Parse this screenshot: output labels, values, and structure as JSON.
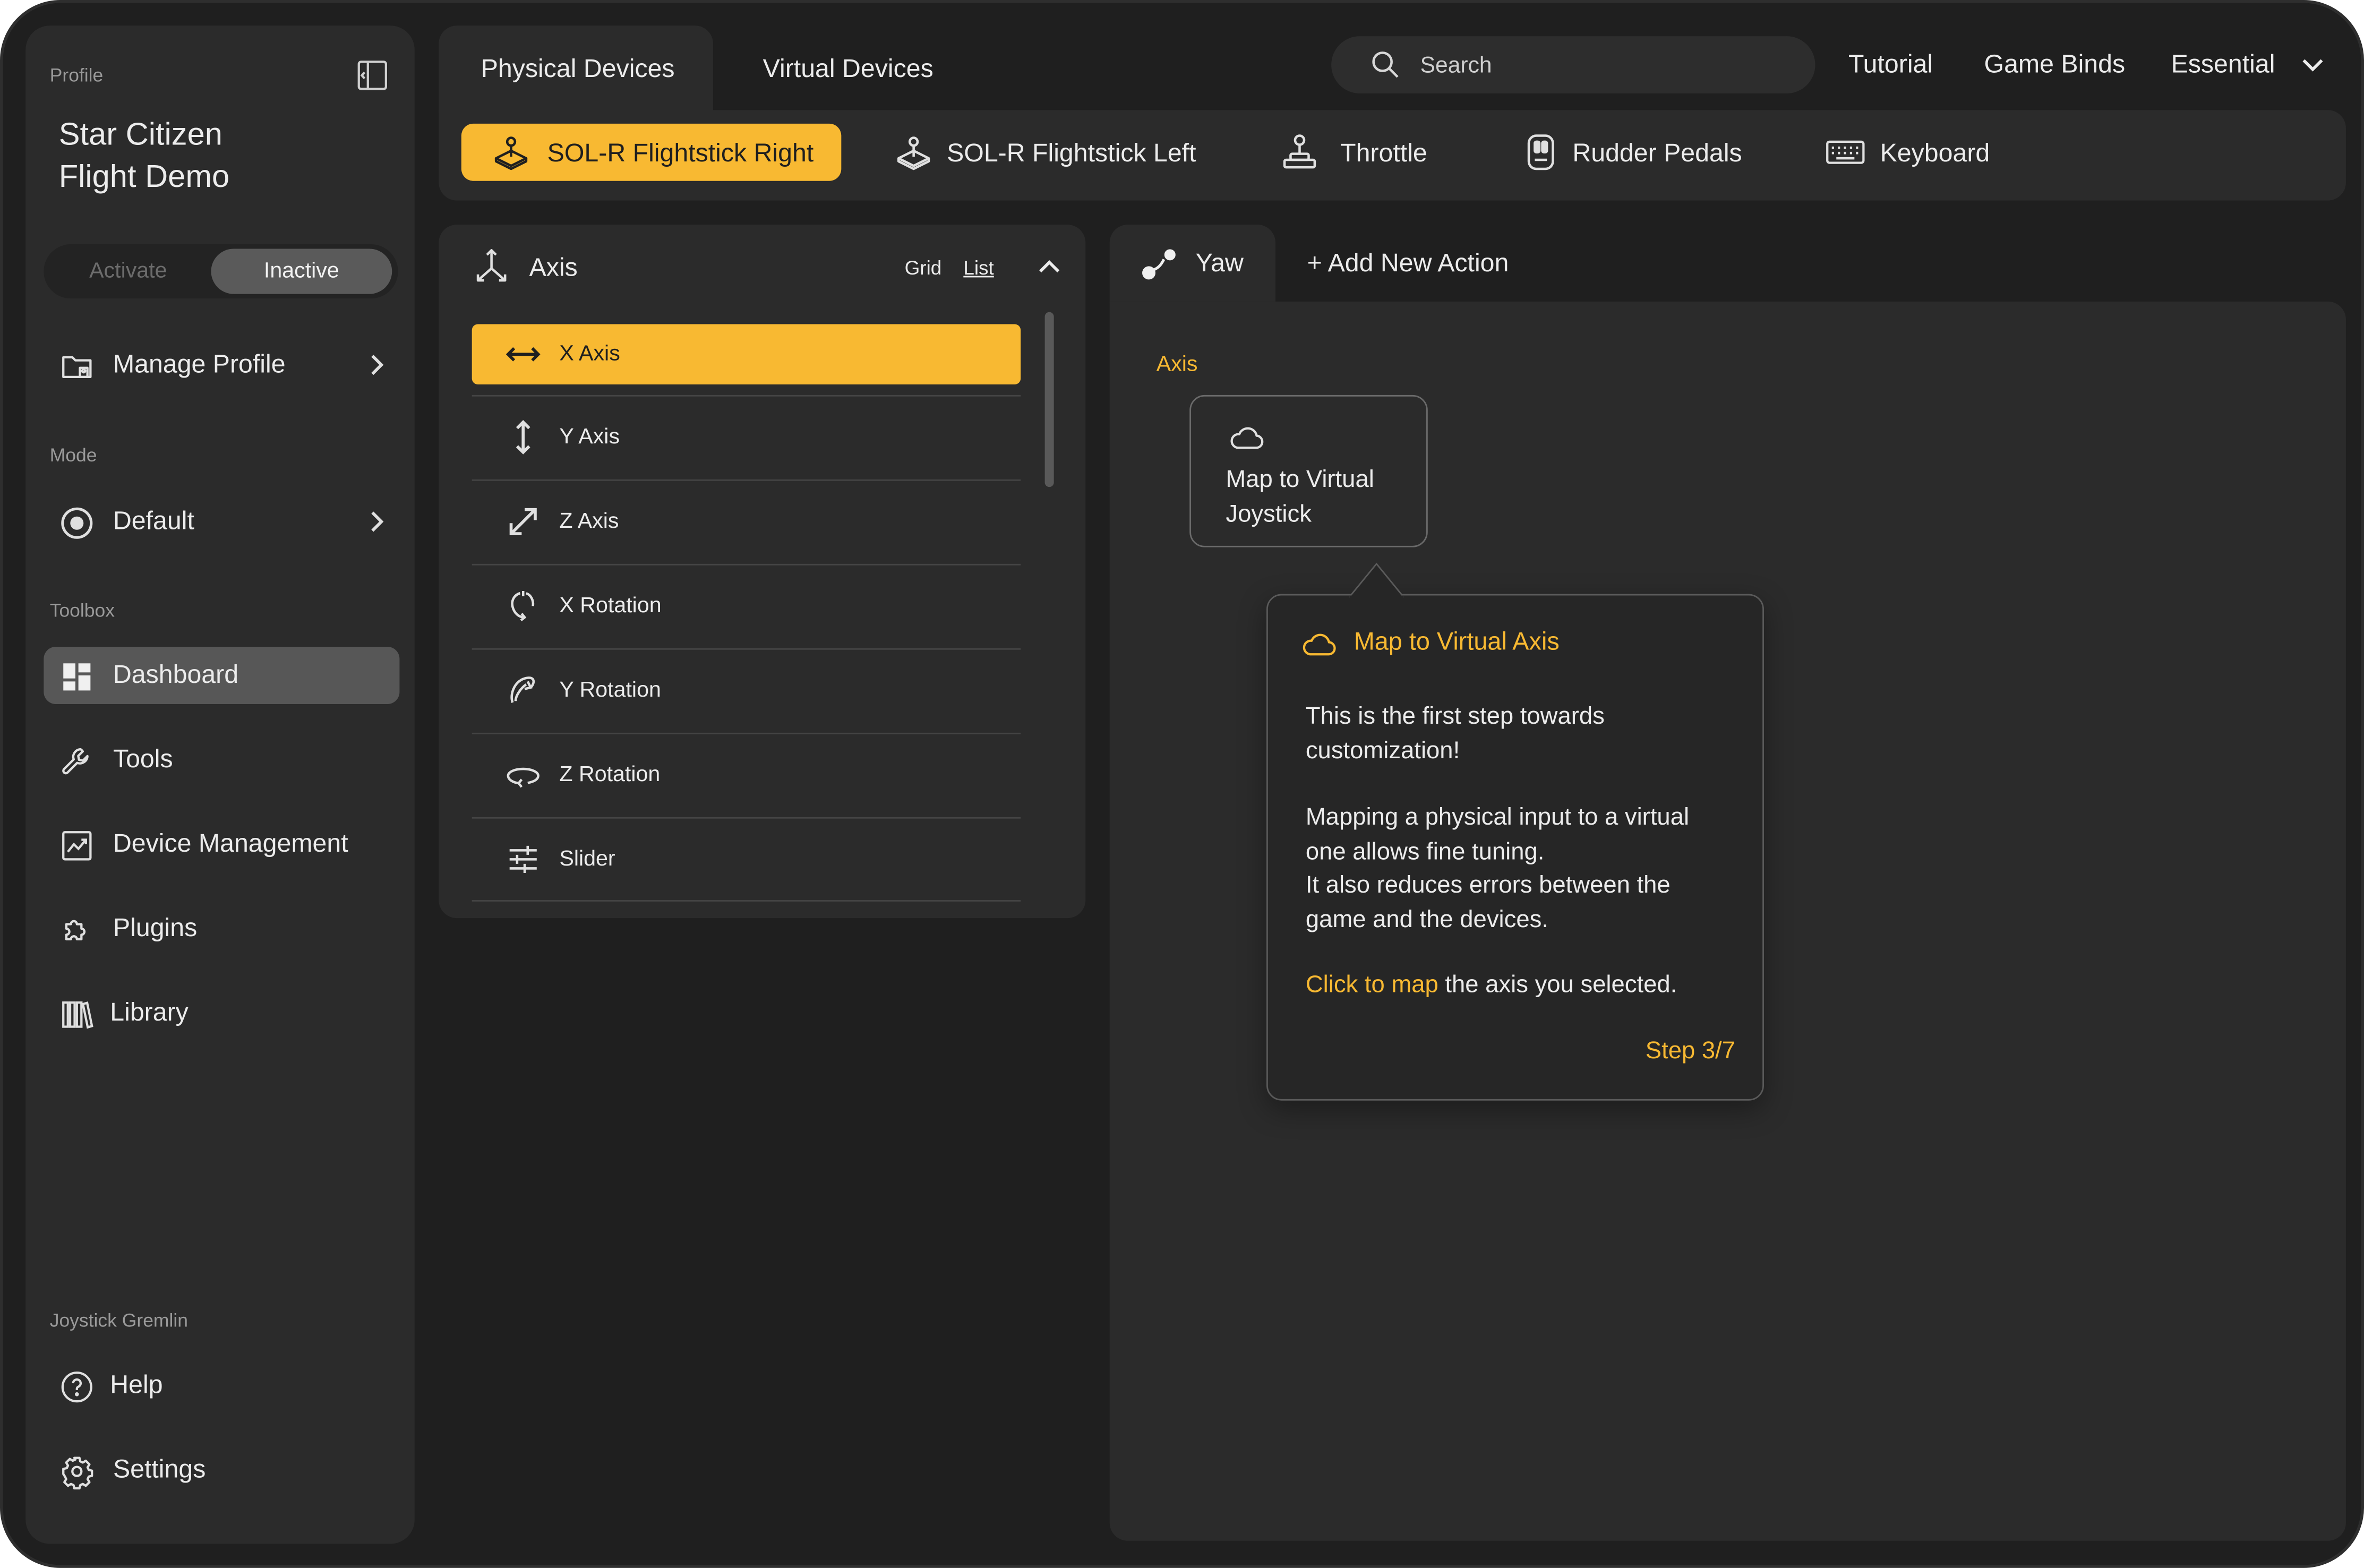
{
  "colors": {
    "accent": "#f8b932",
    "background": "#1f1f1f",
    "panel": "#2b2b2b",
    "text": "#ececec",
    "muted": "#9a9a9a"
  },
  "sidebar": {
    "profile_label": "Profile",
    "collapse_icon": "sidebar-collapse-icon",
    "profile_name_line1": "Star Citizen",
    "profile_name_line2": "Flight Demo",
    "toggle": {
      "activate": "Activate",
      "inactive": "Inactive",
      "selected": "Inactive"
    },
    "manage_profile": {
      "label": "Manage Profile",
      "icon": "folder-icon"
    },
    "mode_label": "Mode",
    "mode": {
      "label": "Default",
      "icon": "radio-target-icon"
    },
    "toolbox_label": "Toolbox",
    "toolbox_items": [
      {
        "label": "Dashboard",
        "icon": "dashboard-icon",
        "active": true
      },
      {
        "label": "Tools",
        "icon": "wrench-icon"
      },
      {
        "label": "Device Management",
        "icon": "chart-icon"
      },
      {
        "label": "Plugins",
        "icon": "puzzle-icon"
      },
      {
        "label": "Library",
        "icon": "library-icon"
      }
    ],
    "app_label": "Joystick Gremlin",
    "footer_items": [
      {
        "label": "Help",
        "icon": "help-icon"
      },
      {
        "label": "Settings",
        "icon": "gear-icon"
      }
    ]
  },
  "header": {
    "tabs": [
      {
        "label": "Physical Devices",
        "active": true
      },
      {
        "label": "Virtual Devices"
      }
    ],
    "search": {
      "placeholder": "Search",
      "icon": "search-icon"
    },
    "links": {
      "tutorial": "Tutorial",
      "game_binds": "Game Binds",
      "essential": "Essential"
    }
  },
  "devices": [
    {
      "label": "SOL-R Flightstick Right",
      "icon": "joystick-icon",
      "active": true
    },
    {
      "label": "SOL-R Flightstick Left",
      "icon": "joystick-icon"
    },
    {
      "label": "Throttle",
      "icon": "throttle-icon"
    },
    {
      "label": "Rudder Pedals",
      "icon": "pedals-icon"
    },
    {
      "label": "Keyboard",
      "icon": "keyboard-icon"
    }
  ],
  "axis_panel": {
    "title": "Axis",
    "view_grid": "Grid",
    "view_list": "List",
    "items": [
      {
        "label": "X Axis",
        "icon": "horizontal-arrows-icon",
        "active": true
      },
      {
        "label": "Y Axis",
        "icon": "vertical-arrows-icon"
      },
      {
        "label": "Z Axis",
        "icon": "diagonal-arrows-icon"
      },
      {
        "label": "X Rotation",
        "icon": "x-rotation-icon"
      },
      {
        "label": "Y Rotation",
        "icon": "y-rotation-icon"
      },
      {
        "label": "Z Rotation",
        "icon": "z-rotation-icon"
      },
      {
        "label": "Slider",
        "icon": "slider-icon"
      }
    ]
  },
  "action_tabs": {
    "yaw": "Yaw",
    "add_new": "+ Add New Action"
  },
  "action_area": {
    "section_label": "Axis",
    "card": {
      "line1": "Map to Virtual",
      "line2": "Joystick",
      "icon": "cloud-icon"
    }
  },
  "tooltip": {
    "title": "Map to Virtual Axis",
    "p1_line1": "This is the first step towards",
    "p1_line2": "customization!",
    "p2_line1": "Mapping a physical input to a virtual",
    "p2_line2": "one allows fine tuning.",
    "p2_line3": "It also reduces errors between the",
    "p2_line4": "game and the devices.",
    "cta_link": "Click to map",
    "cta_rest": " the axis you selected.",
    "step": "Step 3/7"
  }
}
